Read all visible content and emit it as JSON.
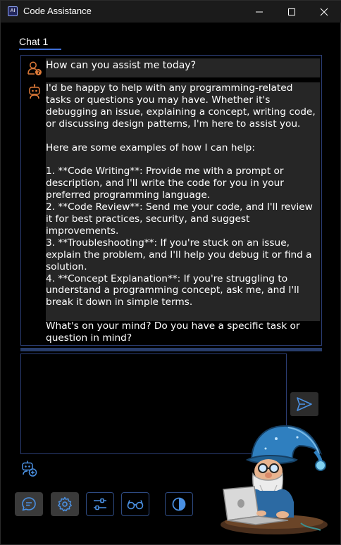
{
  "window": {
    "title": "Code Assistance",
    "app_icon_text": "AI"
  },
  "tabs": [
    {
      "label": "Chat 1",
      "active": true
    }
  ],
  "messages": {
    "user": {
      "icon": "user-question-icon",
      "text": "How can you assist me today?"
    },
    "assistant": {
      "icon": "robot-icon",
      "text": "I'd be happy to help with any programming-related tasks or questions you may have. Whether it's debugging an issue, explaining a concept, writing code, or discussing design patterns, I'm here to assist you.\n\nHere are some examples of how I can help:\n\n1. **Code Writing**: Provide me with a prompt or description, and I'll write the code for you in your preferred programming language.\n2. **Code Review**: Send me your code, and I'll review it for best practices, security, and suggest improvements.\n3. **Troubleshooting**: If you're stuck on an issue, explain the problem, and I'll help you debug it or find a solution.\n4. **Concept Explanation**: If you're struggling to understand a programming concept, ask me, and I'll break it down in simple terms.\n\nWhat's on your mind? Do you have a specific task or question in mind?"
    }
  },
  "input": {
    "value": "",
    "placeholder": ""
  },
  "icons": {
    "send": "send-icon",
    "new_bot": "add-robot-icon",
    "chat": "chat-bubble-icon",
    "settings": "gear-icon",
    "sliders": "sliders-icon",
    "glasses": "glasses-icon",
    "theme": "contrast-icon",
    "mascot": "wizard-mascot-image"
  },
  "colors": {
    "accent": "#3f6fd8",
    "border": "#2b3d74",
    "user_icon": "#e07b39",
    "bubble": "#262626",
    "send_icon": "#4a90e2"
  }
}
